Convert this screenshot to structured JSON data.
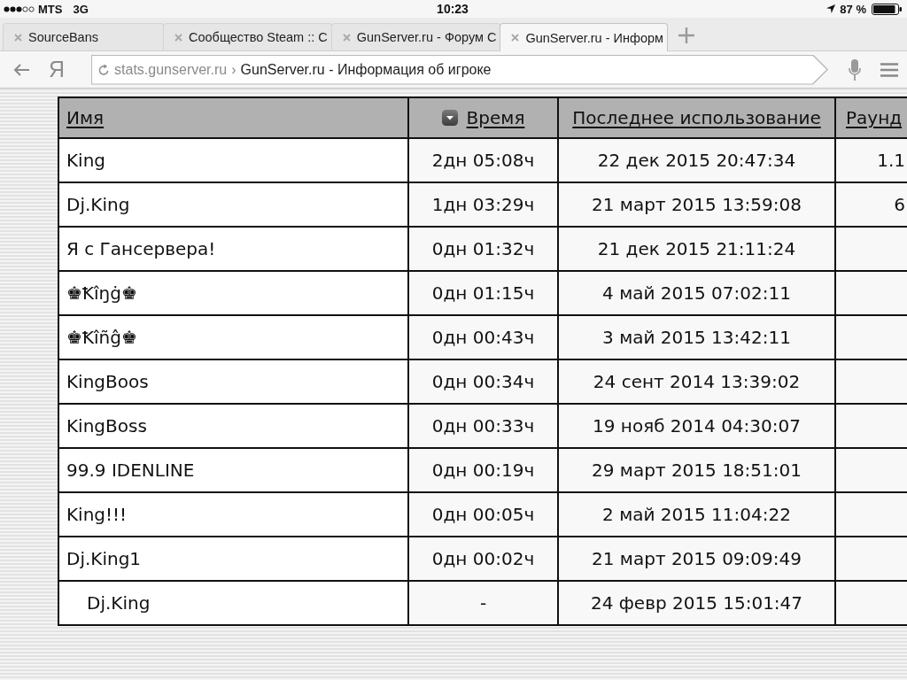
{
  "status_bar": {
    "carrier": "MTS",
    "network": "3G",
    "time": "10:23",
    "battery": "87 %"
  },
  "tabs": [
    {
      "label": "SourceBans",
      "selected": false
    },
    {
      "label": "Сообщество Steam :: С",
      "selected": false
    },
    {
      "label": "GunServer.ru - Форум С",
      "selected": false
    },
    {
      "label": "GunServer.ru - Информ",
      "selected": true
    }
  ],
  "toolbar": {
    "logo": "Я",
    "address": {
      "host": "stats.gunserver.ru",
      "separator": "›",
      "title": "GunServer.ru - Информация об игроке"
    }
  },
  "table": {
    "columns": [
      {
        "label": "Имя",
        "sorted": false
      },
      {
        "label": "Время",
        "sorted": true
      },
      {
        "label": "Последнее использование",
        "sorted": false
      },
      {
        "label": "Раунд",
        "sorted": false
      }
    ],
    "rows": [
      {
        "kind": "main",
        "name": "King",
        "time": "2дн 05:08ч",
        "last_used": "22 дек 2015 20:47:34",
        "rounds": "1.1"
      },
      {
        "kind": "main",
        "name": "Dj.King",
        "time": "1дн 03:29ч",
        "last_used": "21 март 2015 13:59:08",
        "rounds": "6"
      },
      {
        "kind": "main",
        "name": "Я с Гансервера!",
        "time": "0дн 01:32ч",
        "last_used": "21 дек 2015 21:11:24"
      },
      {
        "kind": "main",
        "name": "♚Ꝁîŋġ♚",
        "time": "0дн 01:15ч",
        "last_used": "4 май 2015 07:02:11"
      },
      {
        "kind": "main",
        "name": "♚Ꝁîñĝ♚",
        "time": "0дн 00:43ч",
        "last_used": "3 май 2015 13:42:11"
      },
      {
        "kind": "main",
        "name": "KingBoos",
        "time": "0дн 00:34ч",
        "last_used": "24 сент 2014 13:39:02"
      },
      {
        "kind": "main",
        "name": "KingBoss",
        "time": "0дн 00:33ч",
        "last_used": "19 нояб 2014 04:30:07"
      },
      {
        "kind": "main",
        "name": "99.9 IDENLINE",
        "time": "0дн 00:19ч",
        "last_used": "29 март 2015 18:51:01"
      },
      {
        "kind": "main",
        "name": "King!!!",
        "time": "0дн 00:05ч",
        "last_used": "2 май 2015 11:04:22"
      },
      {
        "kind": "main",
        "name": "Dj.King1",
        "time": "0дн 00:02ч",
        "last_used": "21 март 2015 09:09:49"
      },
      {
        "kind": "nested",
        "name": "Dj.King",
        "time": "-",
        "last_used": "24 февр 2015 15:01:47"
      }
    ]
  }
}
